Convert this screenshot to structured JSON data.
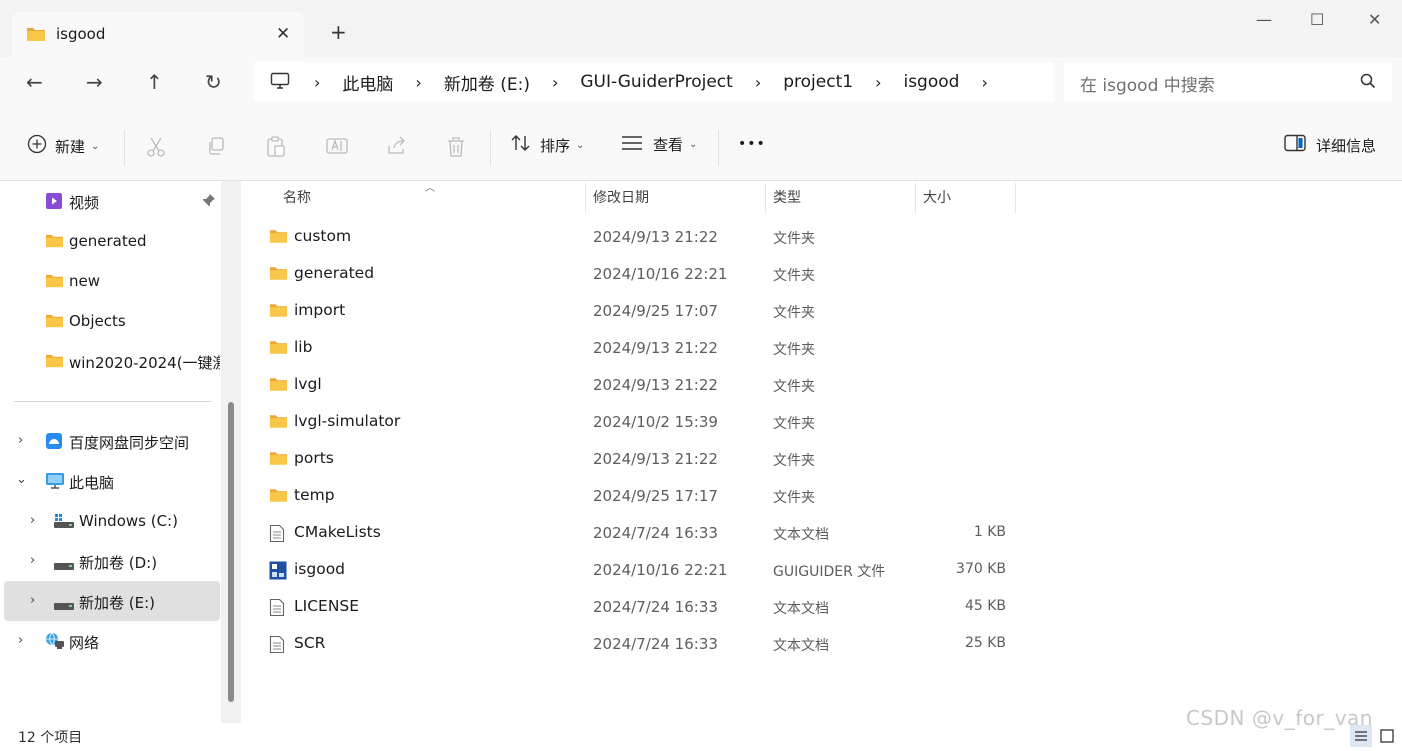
{
  "tab": {
    "title": "isgood",
    "close": "✕",
    "new": "+"
  },
  "window": {
    "minimize": "—",
    "maximize": "☐",
    "close": "✕"
  },
  "nav": {
    "back": "←",
    "forward": "→",
    "up": "↑",
    "refresh": "↻"
  },
  "breadcrumbs": [
    "此电脑",
    "新加卷 (E:)",
    "GUI-GuiderProject",
    "project1",
    "isgood"
  ],
  "search": {
    "placeholder": "在 isgood 中搜索"
  },
  "commands": {
    "new": "新建",
    "sort": "排序",
    "view": "查看",
    "more": "•••",
    "details": "详细信息"
  },
  "sidebar": {
    "items": [
      {
        "label": "视频",
        "icon": "video-icon"
      },
      {
        "label": "generated",
        "icon": "folder-icon"
      },
      {
        "label": "new",
        "icon": "folder-icon"
      },
      {
        "label": "Objects",
        "icon": "folder-icon"
      },
      {
        "label": "win2020-2024(一键激",
        "icon": "folder-icon"
      },
      {
        "label": "百度网盘同步空间",
        "icon": "baidu-drive-icon"
      },
      {
        "label": "此电脑",
        "icon": "computer-icon"
      },
      {
        "label": "Windows (C:)",
        "icon": "windows-drive-icon"
      },
      {
        "label": "新加卷 (D:)",
        "icon": "drive-icon"
      },
      {
        "label": "新加卷 (E:)",
        "icon": "drive-icon"
      },
      {
        "label": "网络",
        "icon": "network-icon"
      }
    ]
  },
  "columns": {
    "name": "名称",
    "date": "修改日期",
    "type": "类型",
    "size": "大小"
  },
  "files": [
    {
      "name": "custom",
      "date": "2024/9/13 21:22",
      "type": "文件夹",
      "size": "",
      "icon": "folder-icon"
    },
    {
      "name": "generated",
      "date": "2024/10/16 22:21",
      "type": "文件夹",
      "size": "",
      "icon": "folder-icon"
    },
    {
      "name": "import",
      "date": "2024/9/25 17:07",
      "type": "文件夹",
      "size": "",
      "icon": "folder-icon"
    },
    {
      "name": "lib",
      "date": "2024/9/13 21:22",
      "type": "文件夹",
      "size": "",
      "icon": "folder-icon"
    },
    {
      "name": "lvgl",
      "date": "2024/9/13 21:22",
      "type": "文件夹",
      "size": "",
      "icon": "folder-icon"
    },
    {
      "name": "lvgl-simulator",
      "date": "2024/10/2 15:39",
      "type": "文件夹",
      "size": "",
      "icon": "folder-icon"
    },
    {
      "name": "ports",
      "date": "2024/9/13 21:22",
      "type": "文件夹",
      "size": "",
      "icon": "folder-icon"
    },
    {
      "name": "temp",
      "date": "2024/9/25 17:17",
      "type": "文件夹",
      "size": "",
      "icon": "folder-icon"
    },
    {
      "name": "CMakeLists",
      "date": "2024/7/24 16:33",
      "type": "文本文档",
      "size": "1 KB",
      "icon": "text-file-icon"
    },
    {
      "name": "isgood",
      "date": "2024/10/16 22:21",
      "type": "GUIGUIDER 文件",
      "size": "370 KB",
      "icon": "guider-file-icon"
    },
    {
      "name": "LICENSE",
      "date": "2024/7/24 16:33",
      "type": "文本文档",
      "size": "45 KB",
      "icon": "text-file-icon"
    },
    {
      "name": "SCR",
      "date": "2024/7/24 16:33",
      "type": "文本文档",
      "size": "25 KB",
      "icon": "text-file-icon"
    }
  ],
  "status": {
    "count": "12 个项目"
  },
  "watermark": "CSDN @v_for_van",
  "colors": {
    "folder": "#f8c74a",
    "folder_dark": "#e8a93a",
    "selection": "#e0e0e0",
    "accent": "#0067c0"
  }
}
